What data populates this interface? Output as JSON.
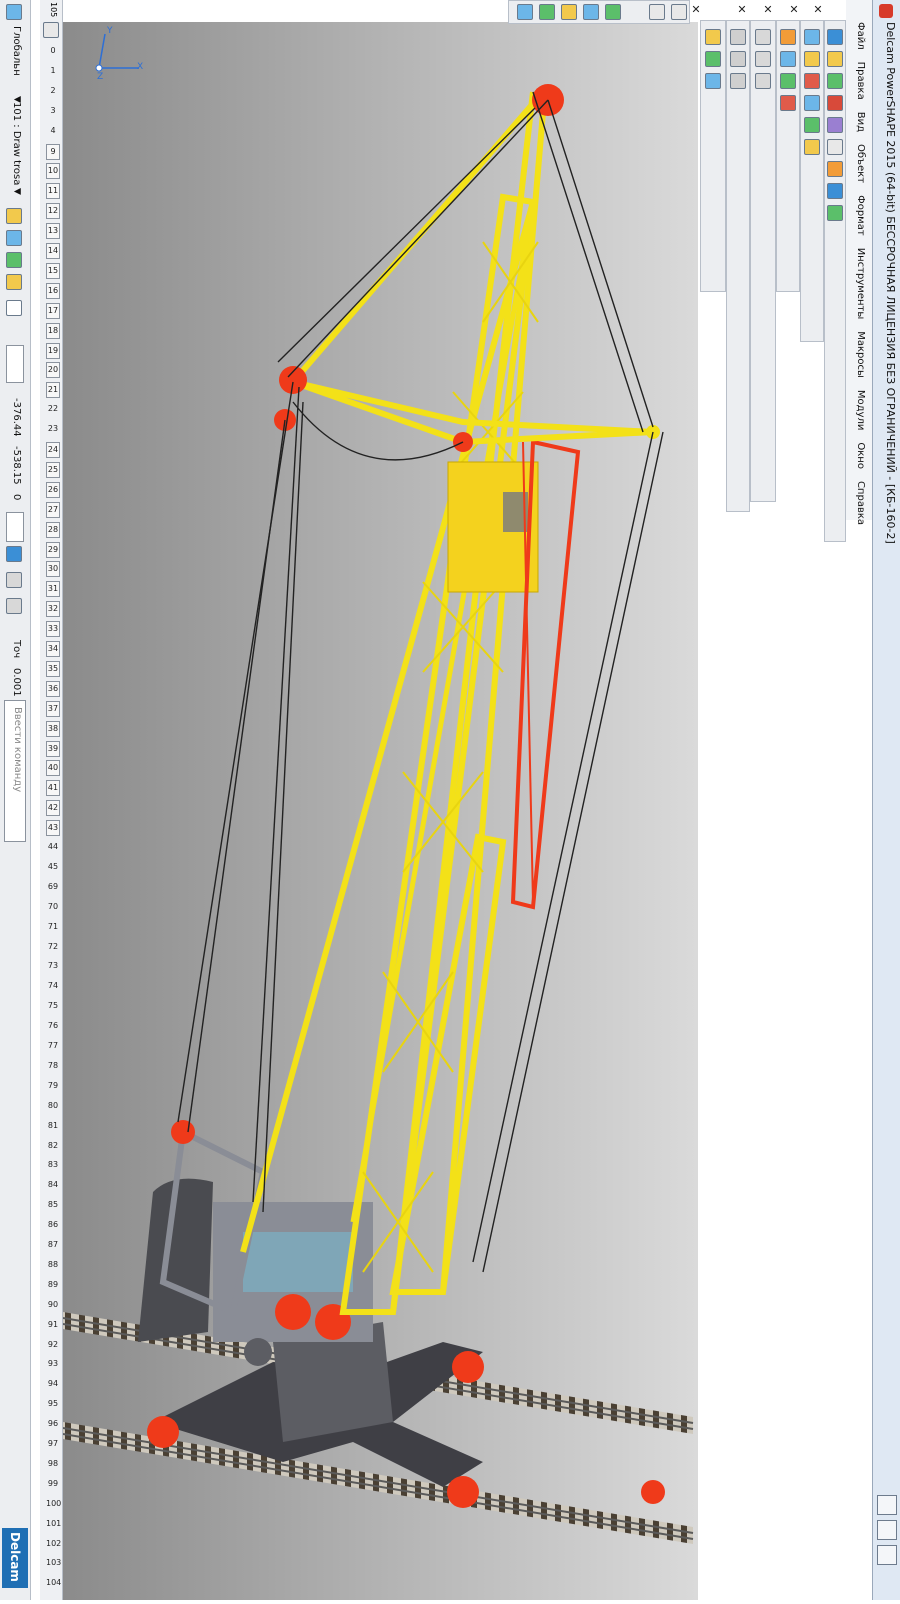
{
  "window": {
    "title": "Delcam PowerSHAPE 2015 (64-bit) БЕССРОЧНАЯ ЛИЦЕНЗИЯ БЕЗ ОГРАНИЧЕНИЙ - [КБ-160-2]"
  },
  "menu": [
    "Файл",
    "Правка",
    "Вид",
    "Объект",
    "Формат",
    "Инструменты",
    "Макросы",
    "Модули",
    "Окно",
    "Справка"
  ],
  "status": {
    "workplane": "Глобальн",
    "level": "101 : Draw trosa",
    "x": "-376.44",
    "y": "-538.15",
    "z": "0",
    "tolerance_label": "Точ",
    "tolerance": "0.001",
    "command_placeholder": "Ввести команду"
  },
  "levels": {
    "top_number": "105",
    "items": [
      "0",
      "1",
      "2",
      "3",
      "4",
      "9",
      "10",
      "11",
      "12",
      "13",
      "14",
      "15",
      "16",
      "17",
      "18",
      "19",
      "20",
      "21",
      "22",
      "23",
      "24",
      "25",
      "26",
      "27",
      "28",
      "29",
      "30",
      "31",
      "32",
      "33",
      "34",
      "35",
      "36",
      "37",
      "38",
      "39",
      "40",
      "41",
      "42",
      "43",
      "44",
      "45",
      "69",
      "70",
      "71",
      "72",
      "73",
      "74",
      "75",
      "76",
      "77",
      "78",
      "79",
      "80",
      "81",
      "82",
      "83",
      "84",
      "85",
      "86",
      "87",
      "88",
      "89",
      "90",
      "91",
      "92",
      "93",
      "94",
      "95",
      "96",
      "97",
      "98",
      "99",
      "100",
      "101",
      "102",
      "103",
      "104"
    ],
    "boxed": [
      "9",
      "10",
      "11",
      "12",
      "13",
      "14",
      "15",
      "16",
      "17",
      "18",
      "19",
      "20",
      "21",
      "24",
      "25",
      "26",
      "27",
      "28",
      "29",
      "30",
      "31",
      "32",
      "33",
      "34",
      "35",
      "36",
      "37",
      "38",
      "39",
      "40",
      "41",
      "42",
      "43"
    ]
  },
  "axes": {
    "x": "X",
    "y": "Y",
    "z": "Z"
  },
  "brand": "Delcam",
  "colors": {
    "boom": "#f3e118",
    "red": "#ef3a1a",
    "steel": "#6d6f78",
    "counterweight": "#4a4b50",
    "viewport_dark": "#8e8e8e",
    "viewport_light": "#d8d8d8"
  },
  "icons": [
    "cursor-icon",
    "surface-icon",
    "solid-icon",
    "wireframe-icon",
    "shaded-icon",
    "view-icon",
    "close-icon",
    "level-icon"
  ]
}
